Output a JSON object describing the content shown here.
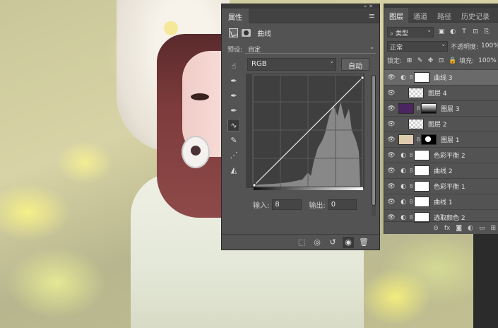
{
  "properties_panel": {
    "tab_label": "属性",
    "title": "曲线",
    "preset_label": "预设:",
    "preset_value": "自定",
    "channel_value": "RGB",
    "auto_label": "自动",
    "input_label": "输入:",
    "input_value": "8",
    "output_label": "输出:",
    "output_value": "0",
    "tools": [
      "hand-adjust-icon",
      "eyedropper-black-icon",
      "eyedropper-gray-icon",
      "eyedropper-white-icon",
      "curve-point-icon",
      "pencil-icon",
      "smooth-icon",
      "clipping-warning-icon"
    ]
  },
  "layers_panel": {
    "tabs": [
      "图层",
      "通道",
      "路径",
      "历史记录"
    ],
    "active_tab": "图层",
    "filter_value": "类型",
    "blend_mode": "正常",
    "opacity_label": "不透明度:",
    "opacity_value": "100%",
    "lock_label": "锁定:",
    "fill_label": "填充:",
    "fill_value": "100%",
    "layers": [
      {
        "name": "曲线 3",
        "kind": "adjustment",
        "thumb": "white",
        "selected": true
      },
      {
        "name": "图层 4",
        "kind": "pixel",
        "thumb": "checker",
        "selected": false
      },
      {
        "name": "图层 3",
        "kind": "pixel-mask",
        "thumb": "purple",
        "mask": "gradient",
        "selected": false
      },
      {
        "name": "图层 2",
        "kind": "pixel",
        "thumb": "checker",
        "selected": false
      },
      {
        "name": "图层 1",
        "kind": "pixel-mask",
        "thumb": "photo",
        "mask": "blackmask",
        "selected": false
      },
      {
        "name": "色彩平衡 2",
        "kind": "adjustment",
        "thumb": "white",
        "selected": false
      },
      {
        "name": "曲线 2",
        "kind": "adjustment",
        "thumb": "white",
        "selected": false
      },
      {
        "name": "色彩平衡 1",
        "kind": "adjustment",
        "thumb": "white",
        "selected": false
      },
      {
        "name": "曲线 1",
        "kind": "adjustment",
        "thumb": "white",
        "selected": false
      },
      {
        "name": "选取颜色 2",
        "kind": "adjustment",
        "thumb": "white",
        "selected": false
      }
    ]
  }
}
